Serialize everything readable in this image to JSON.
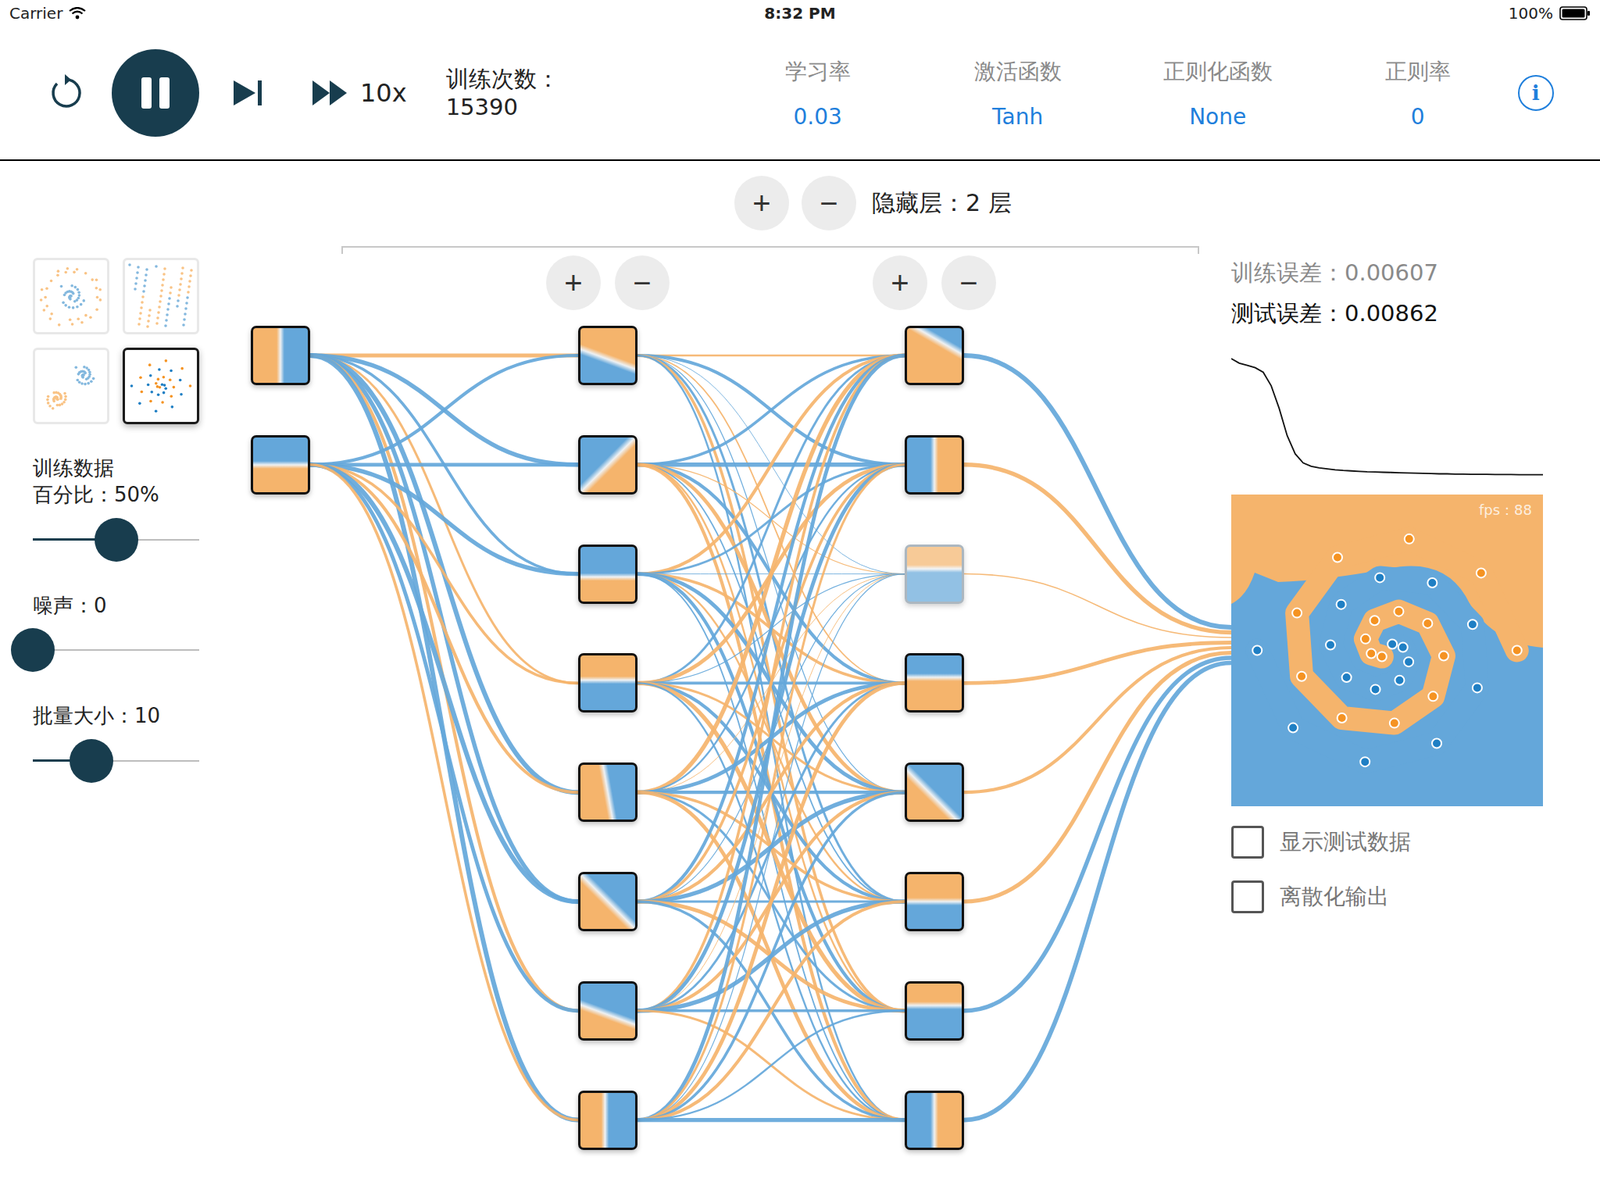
{
  "status_bar": {
    "carrier": "Carrier",
    "time": "8:32 PM",
    "battery": "100%"
  },
  "toolbar": {
    "playing": true,
    "speed": "10x",
    "epoch_label": "训练次数：",
    "epoch": "15390",
    "info": "i",
    "settings": [
      {
        "label": "学习率",
        "value": "0.03"
      },
      {
        "label": "激活函数",
        "value": "Tanh"
      },
      {
        "label": "正则化函数",
        "value": "None"
      },
      {
        "label": "正则率",
        "value": "0"
      }
    ]
  },
  "hidden_layers": {
    "add": "+",
    "remove": "−",
    "label": "隐藏层：2 层"
  },
  "datasets": [
    {
      "kind": "circle",
      "selected": false
    },
    {
      "kind": "xor",
      "selected": false
    },
    {
      "kind": "gauss",
      "selected": false
    },
    {
      "kind": "spiral",
      "selected": true
    }
  ],
  "sliders": [
    {
      "lines": [
        "训练数据",
        "百分比：50%"
      ],
      "level": 0.5
    },
    {
      "lines": [
        "噪声：0"
      ],
      "level": 0
    },
    {
      "lines": [
        "批量大小：10"
      ],
      "level": 0.35
    }
  ],
  "network": {
    "inputs": [
      {
        "angle": 90,
        "split": 0.5,
        "dimmed": false
      },
      {
        "angle": 0,
        "split": 0.5,
        "dimmed": false
      }
    ],
    "layers": [
      [
        {
          "angle": 200,
          "split": 0.55,
          "dimmed": false
        },
        {
          "angle": 315,
          "split": 0.5,
          "dimmed": false
        },
        {
          "angle": 0,
          "split": 0.45,
          "dimmed": false
        },
        {
          "angle": 180,
          "split": 0.45,
          "dimmed": false
        },
        {
          "angle": 80,
          "split": 0.5,
          "dimmed": false
        },
        {
          "angle": 45,
          "split": 0.5,
          "dimmed": false
        },
        {
          "angle": 20,
          "split": 0.45,
          "dimmed": false
        },
        {
          "angle": 90,
          "split": 0.45,
          "dimmed": false
        }
      ],
      [
        {
          "angle": 30,
          "split": 0.7,
          "dimmed": false
        },
        {
          "angle": 270,
          "split": 0.5,
          "dimmed": false
        },
        {
          "angle": 180,
          "split": 0.4,
          "dimmed": true
        },
        {
          "angle": 0,
          "split": 0.6,
          "dimmed": false
        },
        {
          "angle": 45,
          "split": 0.45,
          "dimmed": false
        },
        {
          "angle": 180,
          "split": 0.5,
          "dimmed": false
        },
        {
          "angle": 180,
          "split": 0.4,
          "dimmed": false
        },
        {
          "angle": 270,
          "split": 0.5,
          "dimmed": false
        }
      ]
    ],
    "weights": [
      [
        [
          -0.7,
          0.8,
          0.5,
          -0.4,
          0.9,
          0.8,
          -0.6,
          0.9
        ],
        [
          0.6,
          0.7,
          0.8,
          -0.5,
          -0.6,
          0.9,
          0.7,
          -0.5
        ]
      ],
      [
        [
          -0.3,
          0.6,
          0.05,
          -0.2,
          0.1,
          0.4,
          -0.5,
          0.3
        ],
        [
          0.5,
          0.8,
          -0.1,
          0.6,
          -0.7,
          0.2,
          -0.3,
          -0.6
        ],
        [
          -0.6,
          0.4,
          0.05,
          -0.5,
          0.7,
          -0.3,
          0.6,
          0.2
        ],
        [
          0.4,
          -0.7,
          0.1,
          0.5,
          -0.4,
          0.6,
          -0.8,
          0.3
        ],
        [
          -0.8,
          0.3,
          -0.05,
          0.7,
          0.6,
          -0.5,
          0.4,
          -0.7
        ],
        [
          0.6,
          -0.5,
          0.1,
          -0.6,
          0.8,
          0.4,
          -0.7,
          0.5
        ],
        [
          -0.5,
          0.7,
          -0.05,
          0.4,
          -0.6,
          0.8,
          0.5,
          -0.4
        ],
        [
          0.7,
          -0.4,
          0.1,
          -0.7,
          0.5,
          -0.6,
          0.3,
          0.8
        ]
      ],
      [
        [
          0.9
        ],
        [
          -0.8
        ],
        [
          -0.15
        ],
        [
          -0.7
        ],
        [
          -0.6
        ],
        [
          -0.75
        ],
        [
          0.8
        ],
        [
          0.85
        ]
      ]
    ]
  },
  "errors": [
    {
      "label": "训练误差：",
      "value": "0.00607",
      "muted": true
    },
    {
      "label": "测试误差：",
      "value": "0.00862",
      "muted": false
    }
  ],
  "loss": [
    0.52,
    0.5,
    0.49,
    0.48,
    0.46,
    0.4,
    0.3,
    0.18,
    0.1,
    0.06,
    0.045,
    0.038,
    0.034,
    0.03,
    0.027,
    0.025,
    0.023,
    0.021,
    0.02,
    0.019,
    0.018,
    0.017,
    0.016,
    0.015,
    0.014,
    0.013,
    0.012,
    0.012,
    0.011,
    0.011,
    0.01,
    0.01,
    0.01,
    0.009,
    0.009,
    0.009,
    0.008,
    0.008,
    0.008,
    0.008
  ],
  "output": {
    "fps": "fps：88",
    "classes": [
      {
        "color": "#1f7fc4",
        "points": [
          [
            0.2,
            0.24
          ],
          [
            0.61,
            0.12
          ],
          [
            0.83,
            -0.44
          ],
          [
            0.48,
            -1.15
          ],
          [
            -0.45,
            -1.5
          ],
          [
            -1.56,
            -1.04
          ],
          [
            -2.18,
            0.21
          ],
          [
            -1.77,
            1.77
          ],
          [
            -0.28,
            2.8
          ],
          [
            1.74,
            2.6
          ],
          [
            3.29,
            1.0
          ],
          [
            3.47,
            -1.44
          ],
          [
            1.91,
            -3.58
          ],
          [
            -0.85,
            -4.29
          ],
          [
            -3.62,
            -2.98
          ],
          [
            -5.0,
            0.0
          ]
        ]
      },
      {
        "color": "#f59322",
        "points": [
          [
            -0.2,
            -0.24
          ],
          [
            -0.61,
            -0.12
          ],
          [
            -0.83,
            0.44
          ],
          [
            -0.48,
            1.15
          ],
          [
            0.45,
            1.5
          ],
          [
            1.56,
            1.04
          ],
          [
            2.18,
            -0.21
          ],
          [
            1.77,
            -1.77
          ],
          [
            0.28,
            -2.8
          ],
          [
            -1.74,
            -2.6
          ],
          [
            -3.29,
            -1.0
          ],
          [
            -3.47,
            1.44
          ],
          [
            -1.91,
            3.58
          ],
          [
            0.85,
            4.29
          ],
          [
            3.62,
            2.98
          ],
          [
            5.0,
            0.0
          ]
        ]
      }
    ]
  },
  "checkboxes": [
    {
      "label": "显示测试数据",
      "checked": false
    },
    {
      "label": "离散化输出",
      "checked": false
    }
  ]
}
